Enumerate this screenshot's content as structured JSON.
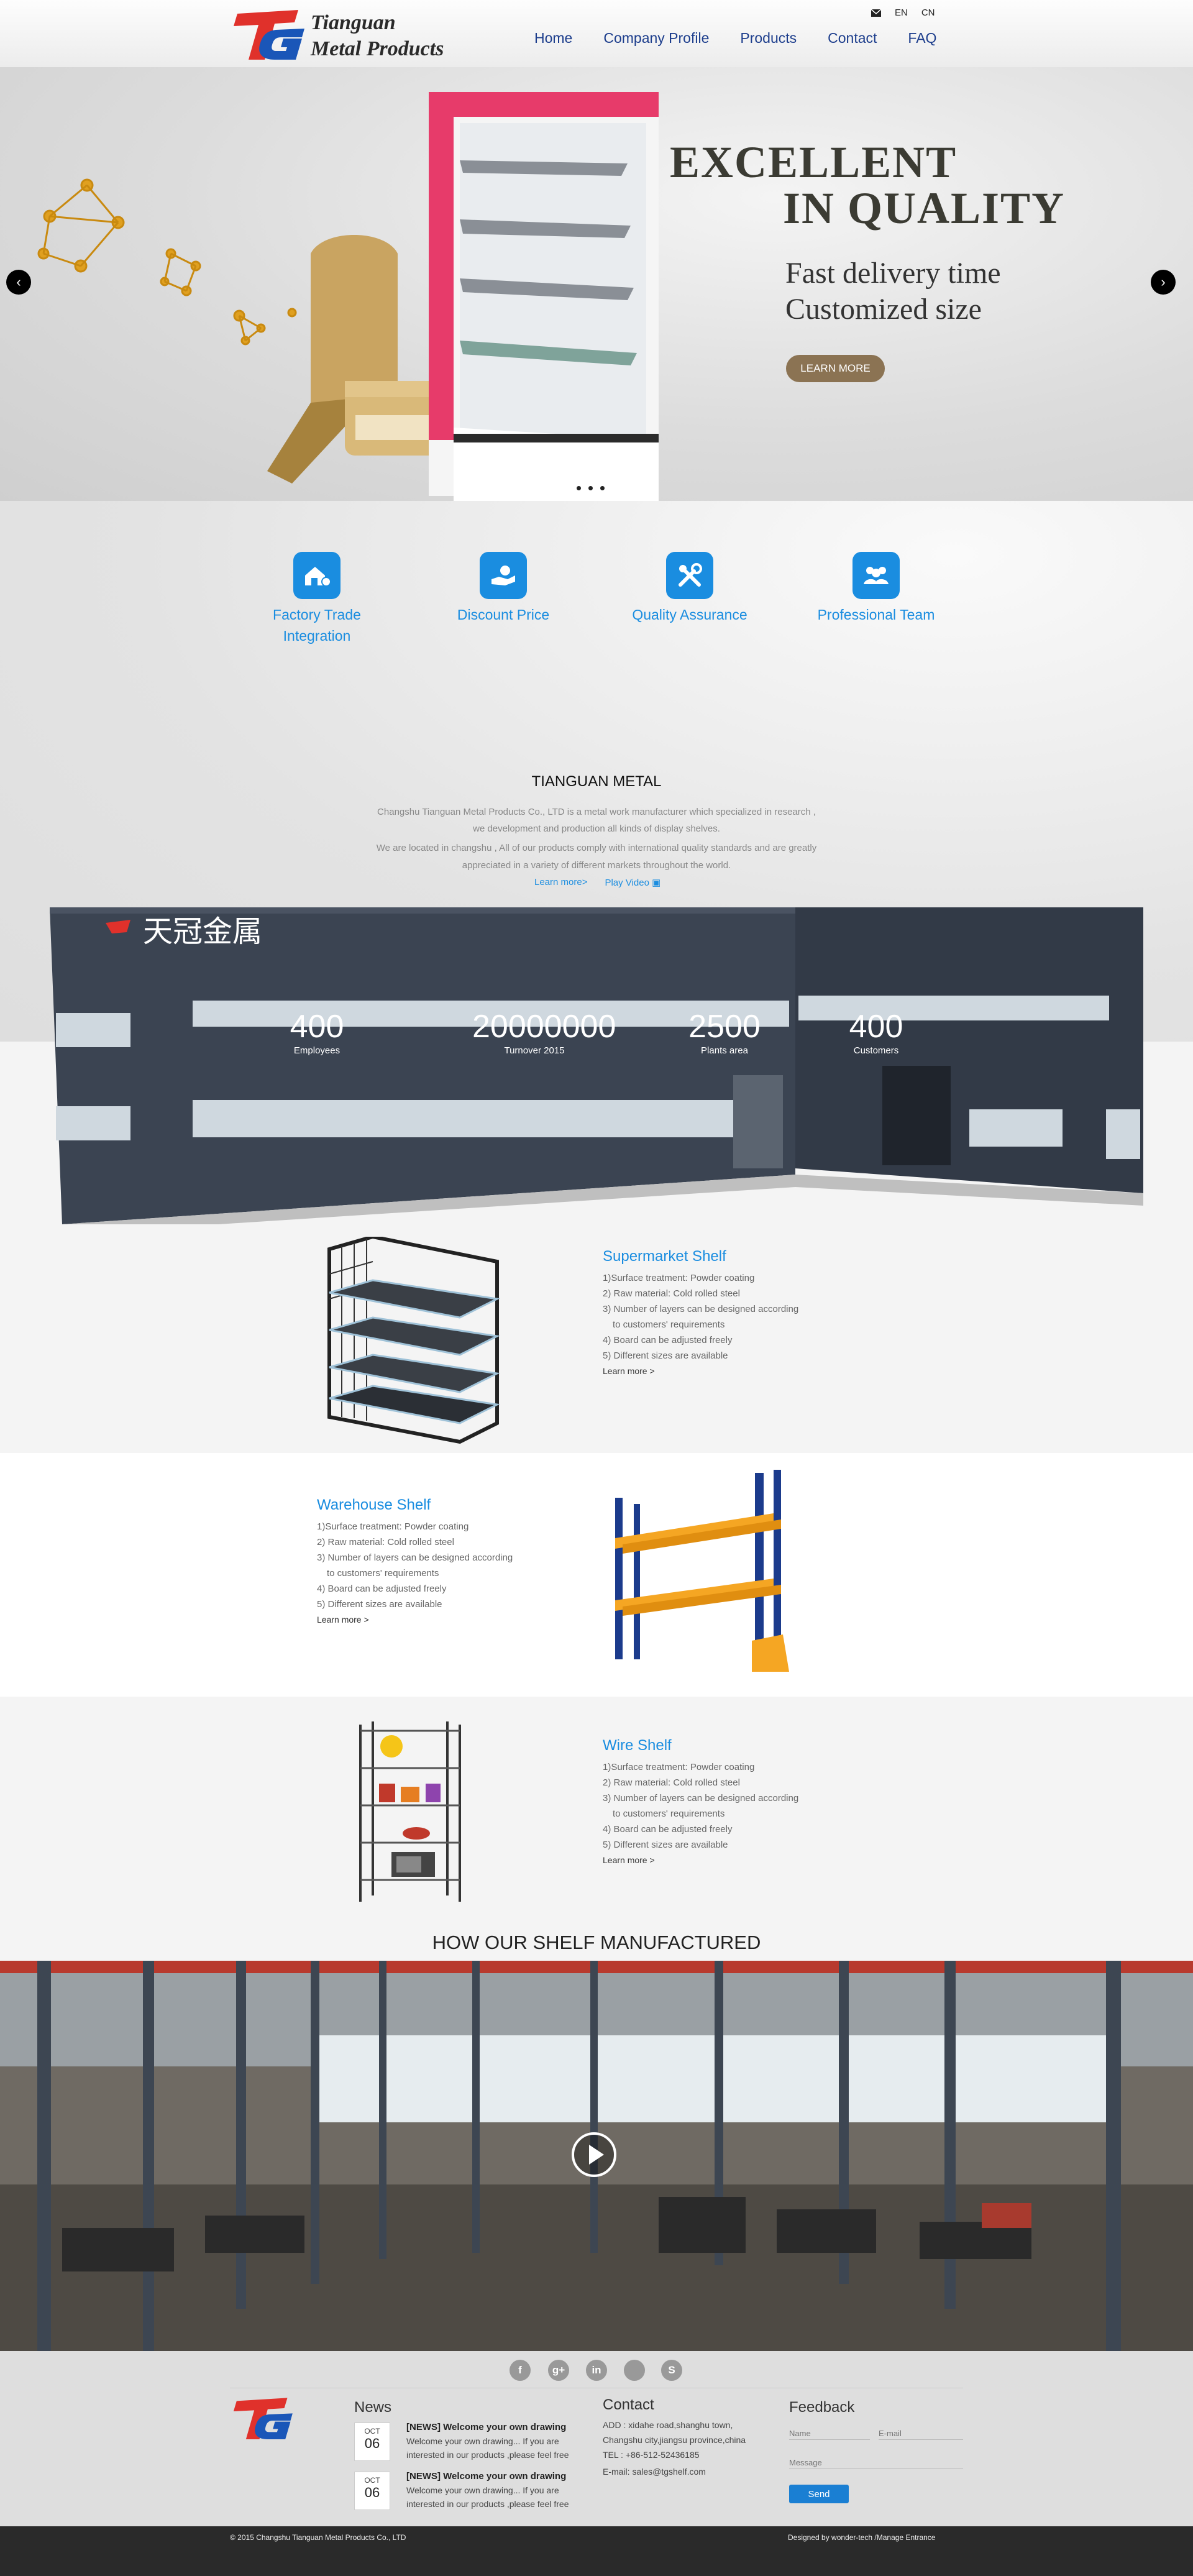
{
  "header": {
    "logo_line1": "Tianguan",
    "logo_line2": "Metal Products",
    "mail_icon": "mail-icon",
    "lang_en": "EN",
    "lang_cn": "CN",
    "nav": [
      "Home",
      "Company Profile",
      "Products",
      "Contact",
      "FAQ"
    ]
  },
  "hero": {
    "title_line1": "EXCELLENT",
    "title_line2": "IN QUALITY",
    "sub_line1": "Fast delivery time",
    "sub_line2": "Customized size",
    "button": "LEARN MORE",
    "prev_icon": "chevron-left-icon",
    "next_icon": "chevron-right-icon",
    "slides": 3
  },
  "features": [
    {
      "icon": "factory-icon",
      "label1": "Factory Trade",
      "label2": "Integration"
    },
    {
      "icon": "price-hand-icon",
      "label1": "Discount Price",
      "label2": ""
    },
    {
      "icon": "tools-icon",
      "label1": "Quality Assurance",
      "label2": ""
    },
    {
      "icon": "team-icon",
      "label1": "Professional Team",
      "label2": ""
    }
  ],
  "about": {
    "title": "TIANGUAN METAL",
    "lines": [
      "Changshu Tianguan Metal Products Co., LTD is a metal work manufacturer which specialized in research ,",
      "we development and production all kinds of display shelves.",
      "We are located in changshu , All of our products comply with international quality standards and are greatly",
      "appreciated in a variety of different markets throughout the world."
    ],
    "learn_more": "Learn more>",
    "play_video": "Play Video",
    "sign_text": "天冠金属"
  },
  "stats": [
    {
      "value": "400",
      "label": "Employees"
    },
    {
      "value": "20000000",
      "label": "Turnover 2015"
    },
    {
      "value": "2500",
      "label": "Plants area"
    },
    {
      "value": "400",
      "label": "Customers"
    }
  ],
  "products": [
    {
      "title": "Supermarket Shelf",
      "items": [
        "1)Surface treatment: Powder coating",
        "2) Raw material: Cold rolled steel",
        "3) Number of layers can be designed according",
        "   to customers' requirements",
        "4) Board can be adjusted freely",
        "5) Different sizes are available"
      ],
      "more": "Learn more >"
    },
    {
      "title": "Warehouse Shelf",
      "items": [
        "1)Surface treatment: Powder coating",
        "2) Raw material: Cold rolled steel",
        "3) Number of layers can be designed according",
        "   to customers' requirements",
        "4) Board can be adjusted freely",
        "5) Different sizes are available"
      ],
      "more": "Learn more >"
    },
    {
      "title": "Wire Shelf",
      "items": [
        "1)Surface treatment: Powder coating",
        "2) Raw material: Cold rolled steel",
        "3) Number of layers can be designed according",
        "   to customers' requirements",
        "4) Board can be adjusted freely",
        "5) Different sizes are available"
      ],
      "more": "Learn more >"
    }
  ],
  "video": {
    "title": "HOW OUR SHELF MANUFACTURED",
    "play_icon": "play-icon"
  },
  "footer": {
    "social": [
      {
        "icon": "facebook-icon",
        "glyph": "f"
      },
      {
        "icon": "google-plus-icon",
        "glyph": "g+"
      },
      {
        "icon": "linkedin-icon",
        "glyph": "in"
      },
      {
        "icon": "skype-icon",
        "glyph": "S"
      }
    ],
    "news_heading": "News",
    "news": [
      {
        "month": "OCT",
        "day": "06",
        "title": "[NEWS] Welcome your own drawing",
        "body": "Welcome your own drawing... If you are interested in our products ,please feel free"
      },
      {
        "month": "OCT",
        "day": "06",
        "title": "[NEWS] Welcome your own drawing",
        "body": "Welcome your own drawing... If you are interested in our products ,please feel free"
      }
    ],
    "contact_heading": "Contact",
    "contact_lines": [
      "ADD : xidahe road,shanghu town,",
      "Changshu city,jiangsu province,china",
      "TEL : +86-512-52436185",
      "E-mail: sales@tgshelf.com"
    ],
    "feedback_heading": "Feedback",
    "name_placeholder": "Name",
    "email_placeholder": "E-mail",
    "message_placeholder": "Message",
    "send": "Send",
    "copyright": "© 2015  Changshu Tianguan Metal Products Co., LTD",
    "designed_by": "Designed by wonder-tech /Manage Entrance"
  },
  "colors": {
    "accent": "#1a8de0",
    "nav": "#1c3d8c",
    "hero_button": "#8b7353",
    "logo_red": "#e0312b",
    "logo_blue": "#1a56b8"
  }
}
